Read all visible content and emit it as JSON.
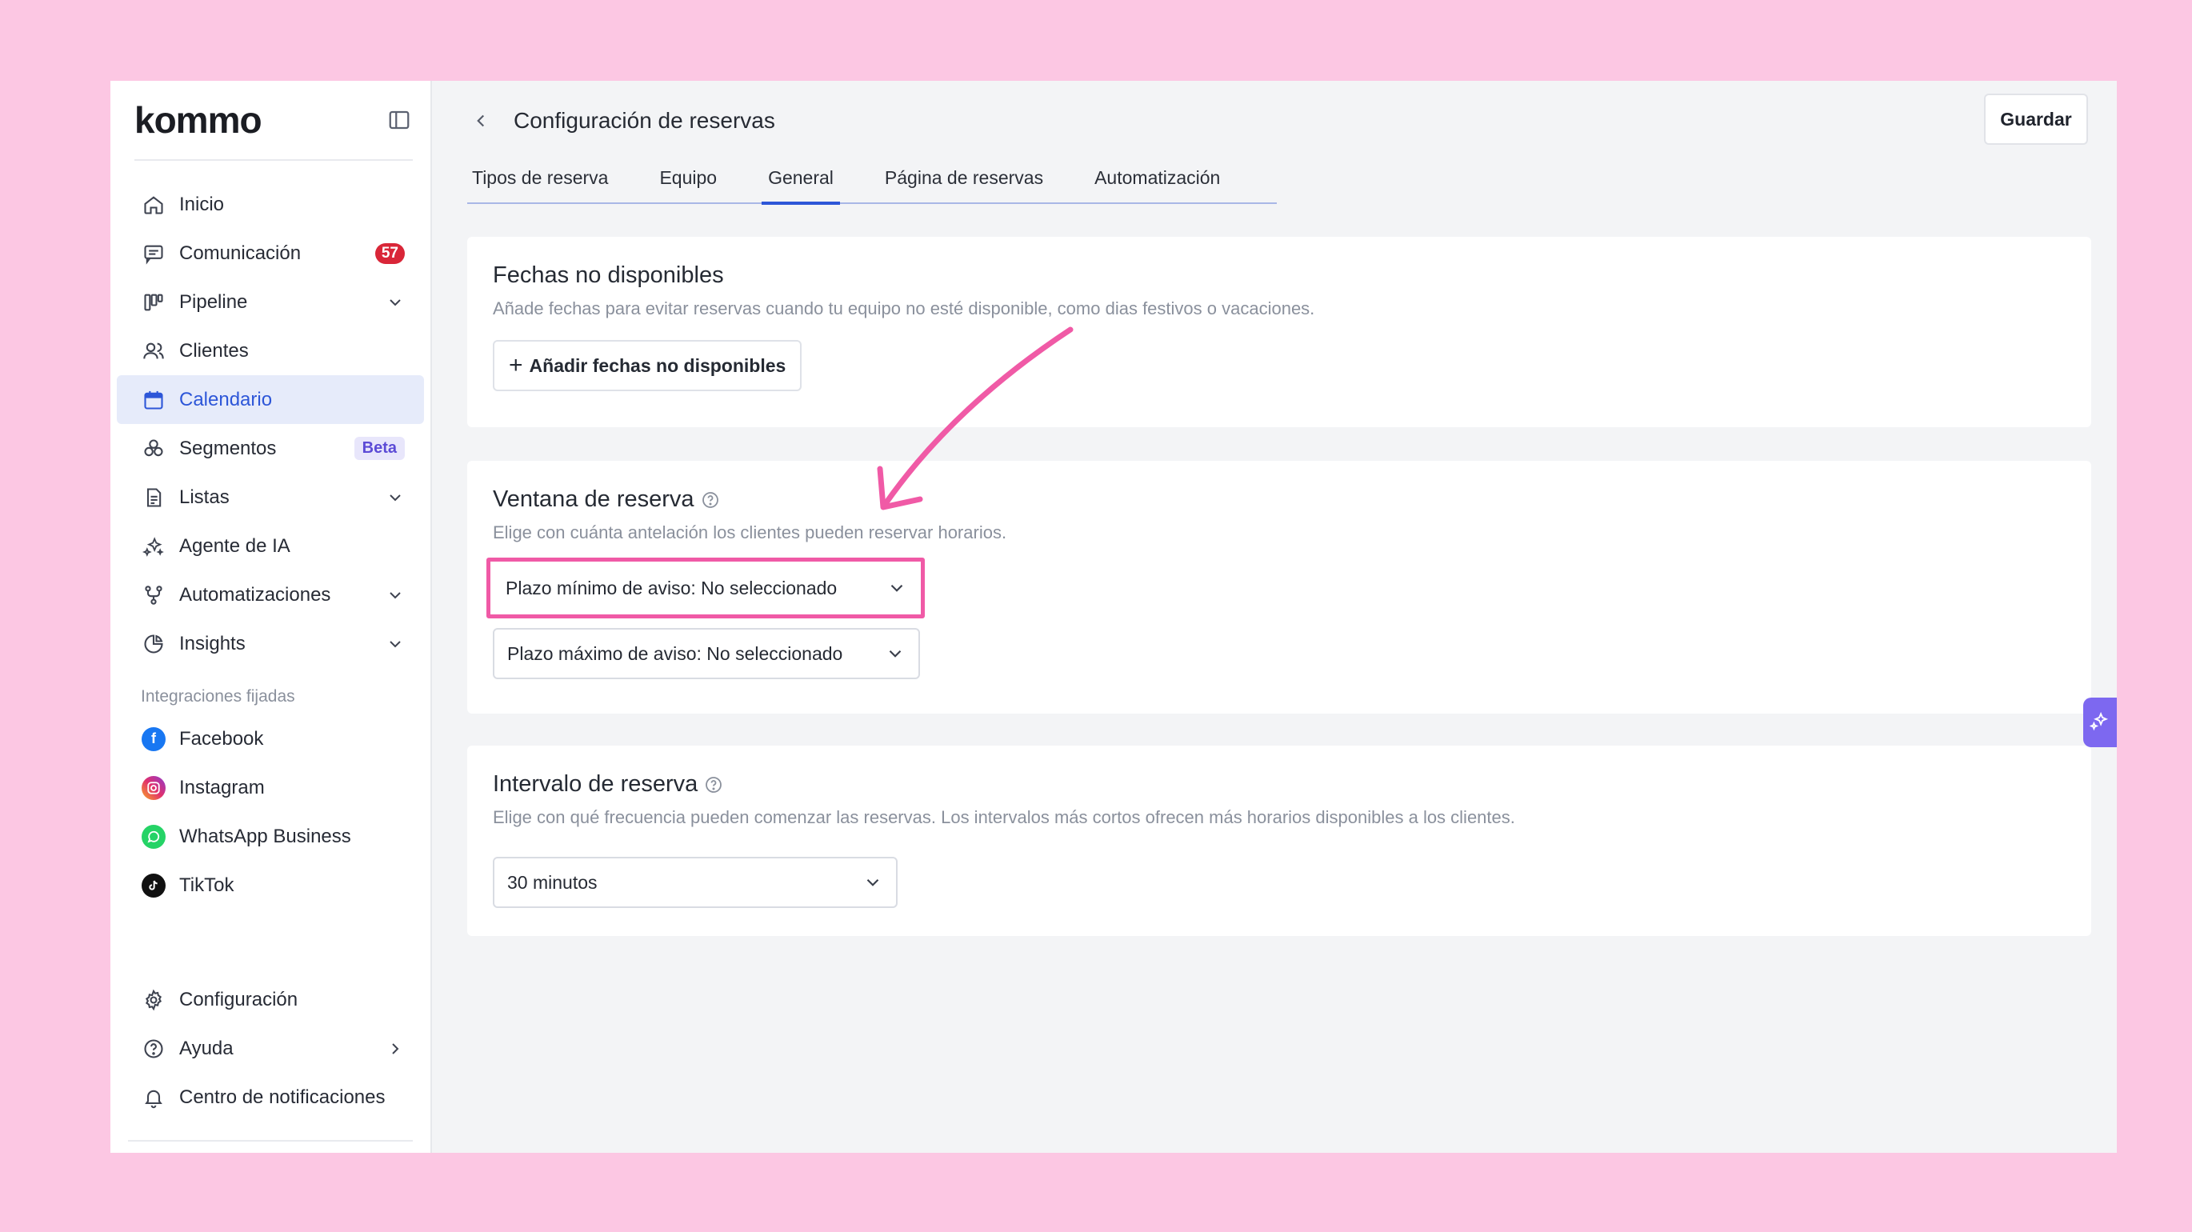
{
  "app": {
    "logo_text": "kommo"
  },
  "sidebar": {
    "items": [
      {
        "label": "Inicio",
        "icon": "home-icon"
      },
      {
        "label": "Comunicación",
        "icon": "chat-icon",
        "badge": "57"
      },
      {
        "label": "Pipeline",
        "icon": "pipeline-icon"
      },
      {
        "label": "Clientes",
        "icon": "users-icon"
      },
      {
        "label": "Calendario",
        "icon": "calendar-icon",
        "active": true
      },
      {
        "label": "Segmentos",
        "icon": "segments-icon",
        "badge": "Beta"
      },
      {
        "label": "Listas",
        "icon": "list-icon"
      },
      {
        "label": "Agente de IA",
        "icon": "sparkle-icon"
      },
      {
        "label": "Automatizaciones",
        "icon": "automation-icon"
      },
      {
        "label": "Insights",
        "icon": "pie-chart-icon"
      }
    ],
    "integrations_label": "Integraciones fijadas",
    "integrations": [
      {
        "label": "Facebook",
        "icon": "facebook-icon",
        "color": "#1877f2"
      },
      {
        "label": "Instagram",
        "icon": "instagram-icon",
        "color": "#e1306c"
      },
      {
        "label": "WhatsApp Business",
        "icon": "whatsapp-icon",
        "color": "#25d366"
      },
      {
        "label": "TikTok",
        "icon": "tiktok-icon",
        "color": "#111111"
      }
    ],
    "bottom": [
      {
        "label": "Configuración",
        "icon": "gear-icon"
      },
      {
        "label": "Ayuda",
        "icon": "help-icon"
      },
      {
        "label": "Centro de notificaciones",
        "icon": "bell-icon"
      }
    ]
  },
  "header": {
    "title": "Configuración de reservas",
    "save_label": "Guardar"
  },
  "tabs": [
    {
      "label": "Tipos de reserva"
    },
    {
      "label": "Equipo"
    },
    {
      "label": "General",
      "active": true
    },
    {
      "label": "Página de reservas"
    },
    {
      "label": "Automatización"
    }
  ],
  "cards": {
    "unavailable": {
      "title": "Fechas no disponibles",
      "description": "Añade fechas para evitar reservas cuando tu equipo no esté disponible, como dias festivos o vacaciones.",
      "button_label": "Añadir fechas no disponibles"
    },
    "window": {
      "title": "Ventana de reserva",
      "description": "Elige con cuánta antelación los clientes pueden reservar horarios.",
      "min_select": "Plazo mínimo de aviso: No seleccionado",
      "max_select": "Plazo máximo de aviso: No seleccionado"
    },
    "interval": {
      "title": "Intervalo de reserva",
      "description": "Elige con qué frecuencia pueden comenzar las reservas. Los intervalos más cortos ofrecen más horarios disponibles a los clientes.",
      "select_value": "30 minutos"
    }
  },
  "colors": {
    "accent": "#2d56d8",
    "highlight": "#f05aa6",
    "background": "#fcc7e3"
  }
}
